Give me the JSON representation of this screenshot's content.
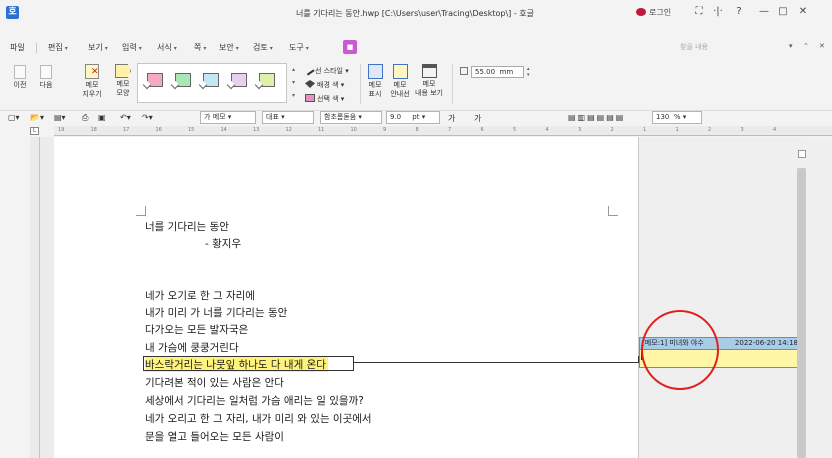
{
  "window": {
    "app_icon_glyph": "호",
    "title": "너를 기다리는 동안.hwp [C:\\Users\\user\\Tracing\\Desktop\\] - 호글",
    "login_label": "로그인",
    "controls": [
      "⛶",
      "·|·",
      "?",
      "—",
      "□",
      "✕"
    ]
  },
  "menu": {
    "items": [
      "파일",
      "편집",
      "보기",
      "입력",
      "서식",
      "쪽",
      "보안",
      "검토",
      "도구"
    ],
    "special_icon": "■",
    "search_placeholder": "찾을 내용",
    "right_controls": [
      "▾",
      "⌃",
      "✕"
    ]
  },
  "ribbon": {
    "prev_label": "이전",
    "next_label": "다음",
    "memo_delete": [
      "메모",
      "지우기"
    ],
    "memo_shape": [
      "메모",
      "모양"
    ],
    "gallery_colors": [
      "#f7a9c4",
      "#a7e8b5",
      "#c6e6f5",
      "#e6d0f2",
      "#dff0a9"
    ],
    "line_style": "선 스타일",
    "bg_color": "배경 색",
    "select_color": "선택 색",
    "memo_show": [
      "메모",
      "표시"
    ],
    "memo_guide": [
      "메모",
      "안내선"
    ],
    "memo_content": [
      "메모",
      "내용 보기"
    ],
    "width_value": "55.00",
    "width_unit": "mm"
  },
  "format_bar": {
    "style_name": "메모",
    "style_prefix": "가",
    "font_category": "대표",
    "font_name": "함초롬돋움",
    "font_size": "9.0",
    "size_unit": "pt",
    "zoom": "130",
    "zoom_unit": "%",
    "text_style_glyphs": [
      "가",
      "가",
      "가",
      "가",
      "가"
    ]
  },
  "ruler": {
    "numbers": [
      "19",
      "18",
      "17",
      "16",
      "15",
      "14",
      "13",
      "12",
      "11",
      "10",
      "9",
      "8",
      "7",
      "6",
      "5",
      "4",
      "3",
      "2",
      "1",
      "1",
      "2",
      "3",
      "4"
    ]
  },
  "document": {
    "lines": [
      "너를 기다리는 동안",
      "- 황지우",
      "네가 오기로 한 그 자리에",
      "내가 미리 가 너를 기다리는 동안",
      "다가오는 모든 발자국은",
      "내 가슴에 쿵쿵거린다",
      "바스락거리는 나뭇잎 하나도 다 내게 온다",
      "기다려본 적이 있는 사람은 안다",
      "세상에서 기다리는 일처럼 가슴 애리는 일 있을까?",
      "네가 오리고 한 그 자리, 내가 미리 와 있는 이곳에서",
      "문을 열고 들어오는 모든 사람이"
    ]
  },
  "memo": {
    "header": "[메모:1] 미녀와 야수",
    "timestamp": "2022-06-20 14:18"
  },
  "colors": {
    "highlight": "#fff37a",
    "memo_header_bg": "#a9cde6",
    "memo_body_bg": "#fff7a6",
    "annotation_circle": "#e0201c"
  }
}
